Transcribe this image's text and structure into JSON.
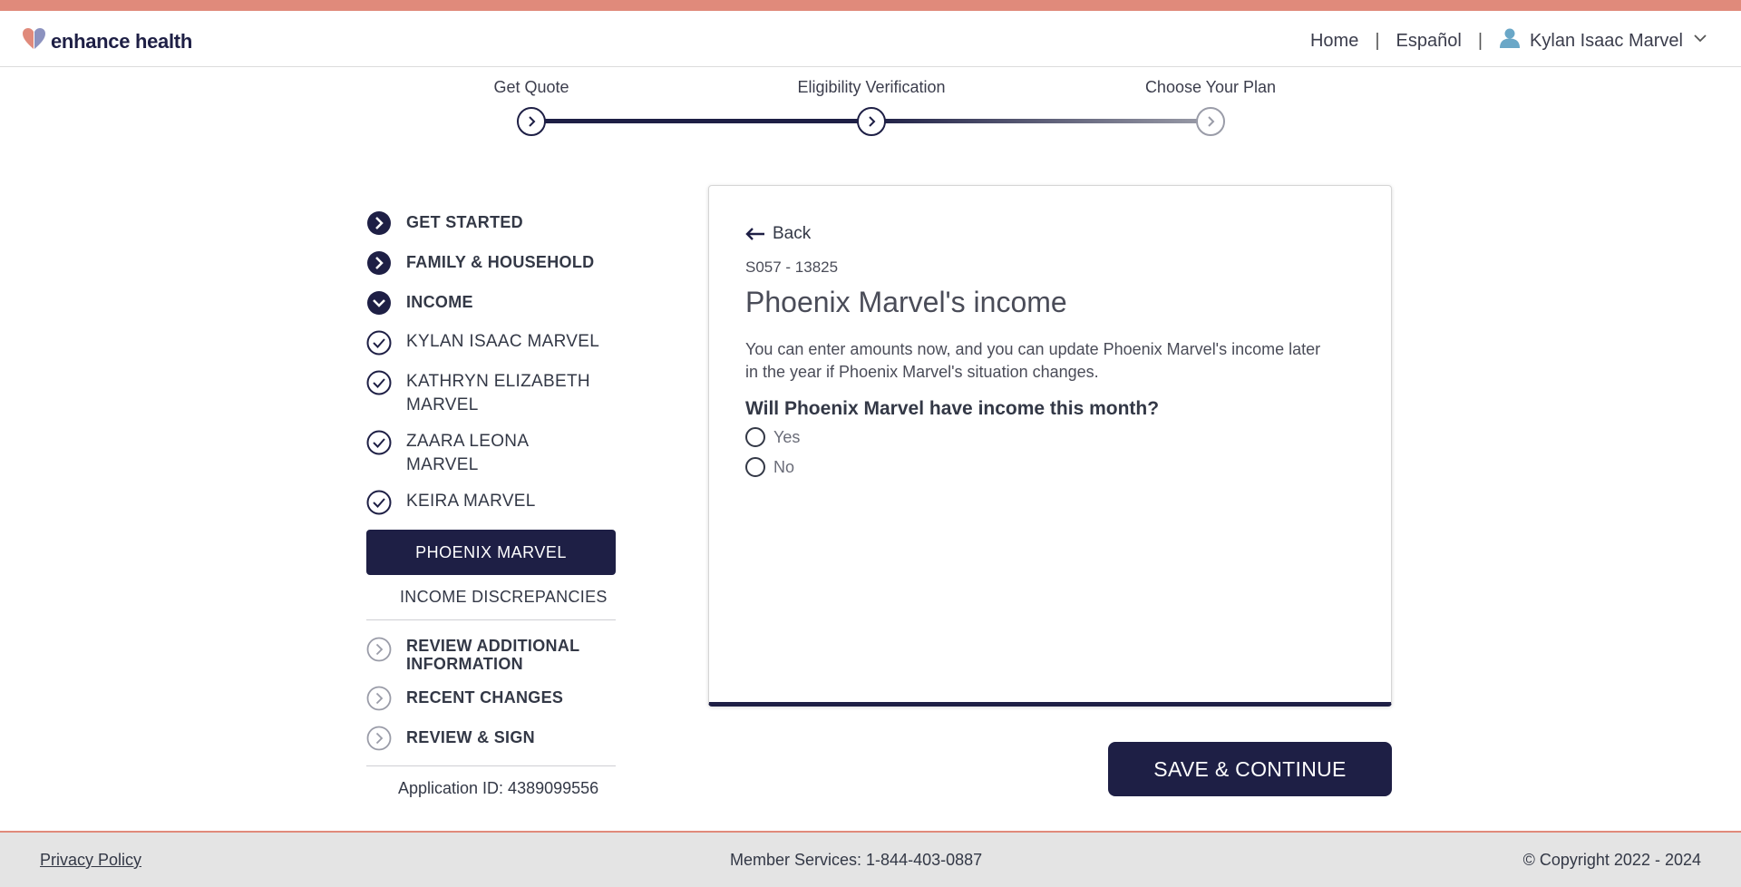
{
  "brand": {
    "name": "enhance health",
    "accent_color": "#e08a7b",
    "primary_color": "#1e1f45"
  },
  "header": {
    "nav": {
      "home": "Home",
      "language": "Español",
      "separator": "|",
      "user_name": "Kylan Isaac Marvel"
    },
    "icons": {
      "user": "user-icon",
      "dropdown": "chevron-down-icon"
    }
  },
  "stepper": {
    "steps": [
      {
        "label": "Get Quote",
        "status": "complete"
      },
      {
        "label": "Eligibility Verification",
        "status": "current"
      },
      {
        "label": "Choose Your Plan",
        "status": "upcoming"
      }
    ]
  },
  "sidebar": {
    "sections": [
      {
        "label": "GET STARTED",
        "state": "complete"
      },
      {
        "label": "FAMILY & HOUSEHOLD",
        "state": "complete"
      },
      {
        "label": "INCOME",
        "state": "expanded"
      }
    ],
    "members": [
      {
        "label": "KYLAN ISAAC MARVEL",
        "state": "checked"
      },
      {
        "label": "KATHRYN ELIZABETH MARVEL",
        "state": "checked"
      },
      {
        "label": "ZAARA LEONA MARVEL",
        "state": "checked"
      },
      {
        "label": "KEIRA MARVEL",
        "state": "checked"
      }
    ],
    "active_member": "PHOENIX MARVEL",
    "discrepancies": "INCOME DISCREPANCIES",
    "upcoming": [
      {
        "label": "REVIEW ADDITIONAL INFORMATION"
      },
      {
        "label": "RECENT CHANGES"
      },
      {
        "label": "REVIEW & SIGN"
      }
    ],
    "application_id": "Application ID: 4389099556"
  },
  "card": {
    "back_label": "Back",
    "case_id": "S057 - 13825",
    "title": "Phoenix Marvel's income",
    "description": "You can enter amounts now, and you can update Phoenix Marvel's income later in the year if Phoenix Marvel's situation changes.",
    "question": "Will Phoenix Marvel have income this month?",
    "options": [
      "Yes",
      "No"
    ],
    "selected_option": null
  },
  "actions": {
    "save_label": "SAVE & CONTINUE"
  },
  "footer": {
    "privacy": "Privacy Policy",
    "member_services": "Member Services: 1-844-403-0887",
    "copyright": "© Copyright 2022 - 2024"
  }
}
